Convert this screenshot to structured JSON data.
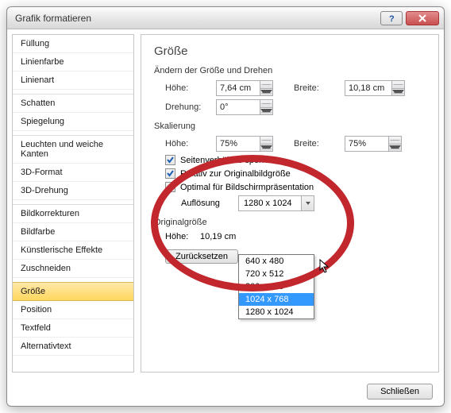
{
  "title": "Grafik formatieren",
  "sidebar": {
    "items": [
      {
        "label": "Füllung"
      },
      {
        "label": "Linienfarbe"
      },
      {
        "label": "Linienart"
      },
      {
        "label": "Schatten"
      },
      {
        "label": "Spiegelung"
      },
      {
        "label": "Leuchten und weiche Kanten"
      },
      {
        "label": "3D-Format"
      },
      {
        "label": "3D-Drehung"
      },
      {
        "label": "Bildkorrekturen"
      },
      {
        "label": "Bildfarbe"
      },
      {
        "label": "Künstlerische Effekte"
      },
      {
        "label": "Zuschneiden"
      },
      {
        "label": "Größe",
        "selected": true
      },
      {
        "label": "Position"
      },
      {
        "label": "Textfeld"
      },
      {
        "label": "Alternativtext"
      }
    ]
  },
  "panel": {
    "heading": "Größe",
    "resize_section": "Ändern der Größe und Drehen",
    "height_label": "Höhe:",
    "width_label": "Breite:",
    "rotation_label": "Drehung:",
    "height_value": "7,64 cm",
    "width_value": "10,18 cm",
    "rotation_value": "0°",
    "scale_section": "Skalierung",
    "scale_height_label": "Höhe:",
    "scale_width_label": "Breite:",
    "scale_height_value": "75%",
    "scale_width_value": "75%",
    "lock_aspect": "Seitenverhältnis sperren",
    "relative_original": "Relativ zur Originalbildgröße",
    "optimal_screen": "Optimal für Bildschirmpräsentation",
    "resolution_label": "Auflösung",
    "resolution_value": "1280 x 1024",
    "resolution_options": [
      "640 x 480",
      "720 x 512",
      "800 x 600",
      "1024 x 768",
      "1280 x 1024"
    ],
    "resolution_hover_index": 3,
    "orig_section": "Originalgröße",
    "orig_height_label": "Höhe:",
    "orig_height_value": "10,19 cm",
    "reset_button": "Zurücksetzen"
  },
  "close_button": "Schließen"
}
